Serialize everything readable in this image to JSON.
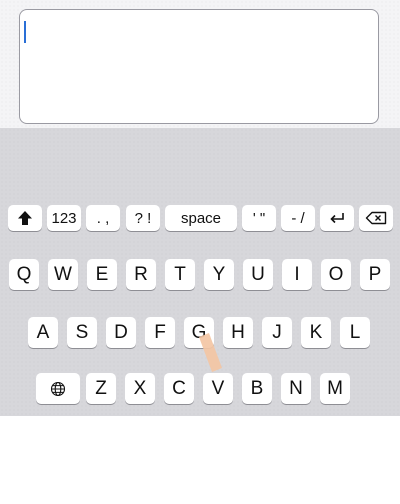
{
  "text_field": {
    "value": ""
  },
  "function_row": {
    "shift_icon": "shift-arrow-icon",
    "numbers_label": "123",
    "period_comma_label": ". ,",
    "question_excl_label": "? !",
    "space_label": "space",
    "quotes_label": "' \"",
    "dash_slash_label": "- /",
    "return_icon": "return-icon",
    "backspace_icon": "backspace-icon"
  },
  "letter_rows": {
    "row1": [
      "Q",
      "W",
      "E",
      "R",
      "T",
      "Y",
      "U",
      "I",
      "O",
      "P"
    ],
    "row2": [
      "A",
      "S",
      "D",
      "F",
      "G",
      "H",
      "J",
      "K",
      "L"
    ],
    "row3": [
      "Z",
      "X",
      "C",
      "V",
      "B",
      "N",
      "M"
    ],
    "globe_icon": "globe-icon"
  },
  "colors": {
    "keyboard_background": "#d7d7db",
    "key_background": "#ffffff",
    "caret": "#2a6fd6",
    "touch_indicator": "#f3c6a4"
  }
}
